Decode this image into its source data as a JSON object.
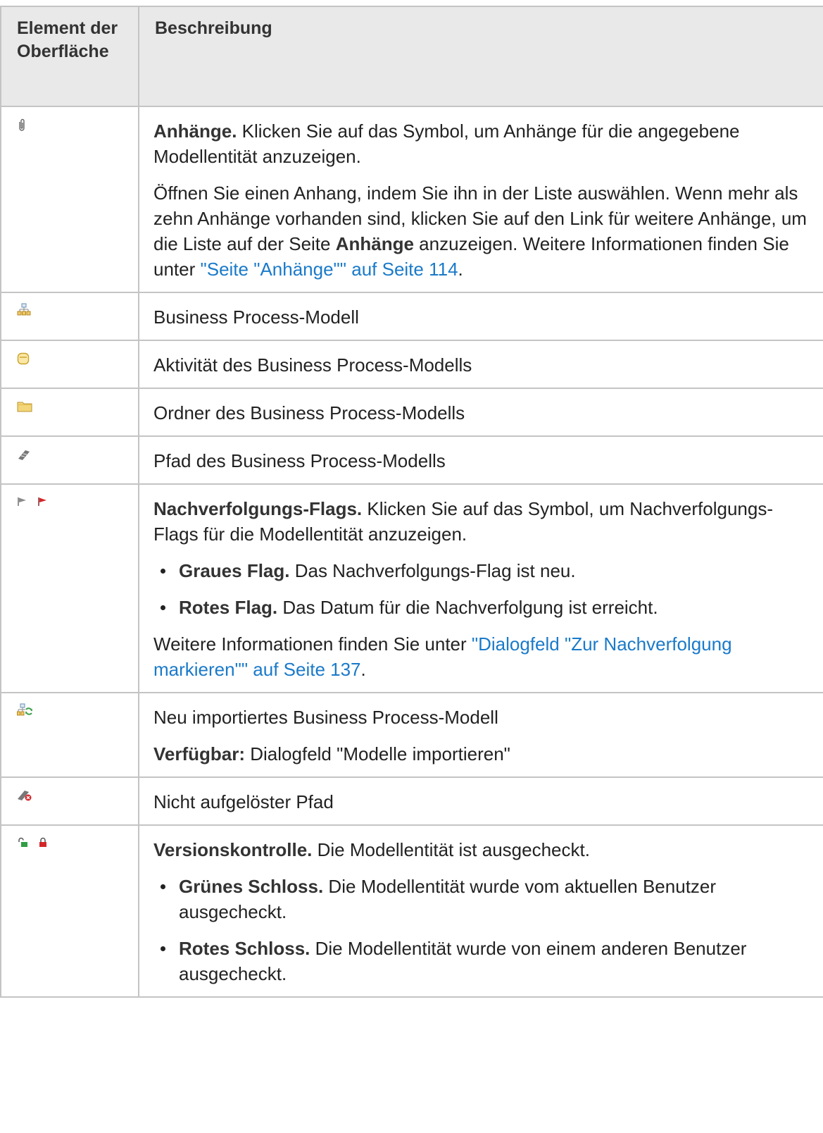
{
  "header": {
    "col1": "Element der Oberfläche",
    "col2": "Beschreibung"
  },
  "rows": {
    "attachments": {
      "icon": "paperclip-icon",
      "title": "Anhänge.",
      "text": " Klicken Sie auf das Symbol, um Anhänge für die angegebene Modellentität anzuzeigen.",
      "p2_text1": "Öffnen Sie einen Anhang, indem Sie ihn in der Liste auswählen. Wenn mehr als zehn Anhänge vorhanden sind, klicken Sie auf den Link für weitere Anhänge, um die Liste auf der Seite ",
      "p2_bold": "Anhänge",
      "p2_text2": " anzuzeigen. Weitere Informationen finden Sie unter ",
      "p2_link": "\"Seite \"Anhänge\"\" auf Seite 114",
      "p2_end": "."
    },
    "bpm": {
      "icon": "business-process-model-icon",
      "text": "Business Process-Modell"
    },
    "activity": {
      "icon": "activity-icon",
      "text": "Aktivität des Business Process-Modells"
    },
    "folder": {
      "icon": "folder-icon",
      "text": "Ordner des Business Process-Modells"
    },
    "path": {
      "icon": "path-icon",
      "text": "Pfad des Business Process-Modells"
    },
    "flags": {
      "icons": [
        "gray-flag-icon",
        "red-flag-icon"
      ],
      "title": "Nachverfolgungs-Flags.",
      "text": " Klicken Sie auf das Symbol, um Nachverfolgungs-Flags für die Modellentität anzuzeigen.",
      "items": [
        {
          "bold": "Graues Flag.",
          "text": " Das Nachverfolgungs-Flag ist neu."
        },
        {
          "bold": "Rotes Flag.",
          "text": " Das Datum für die Nachverfolgung ist erreicht."
        }
      ],
      "more_text": "Weitere Informationen finden Sie unter ",
      "more_link": "\"Dialogfeld \"Zur Nachverfolgung markieren\"\" auf Seite 137",
      "more_end": "."
    },
    "imported": {
      "icon": "imported-model-icon",
      "text": "Neu importiertes Business Process-Modell",
      "avail_bold": "Verfügbar:",
      "avail_text": " Dialogfeld \"Modelle importieren\""
    },
    "unresolved": {
      "icon": "unresolved-path-icon",
      "text": "Nicht aufgelöster Pfad"
    },
    "version": {
      "icons": [
        "green-lock-icon",
        "red-lock-icon"
      ],
      "title": "Versionskontrolle.",
      "text": " Die Modellentität ist ausgecheckt.",
      "items": [
        {
          "bold": "Grünes Schloss.",
          "text": " Die Modellentität wurde vom aktuellen Benutzer ausgecheckt."
        },
        {
          "bold": "Rotes Schloss.",
          "text": " Die Modellentität wurde von einem anderen Benutzer ausgecheckt."
        }
      ]
    }
  },
  "colors": {
    "link": "#1a7ac9",
    "header_bg": "#e9e9e9",
    "border": "#c4c4c4"
  }
}
